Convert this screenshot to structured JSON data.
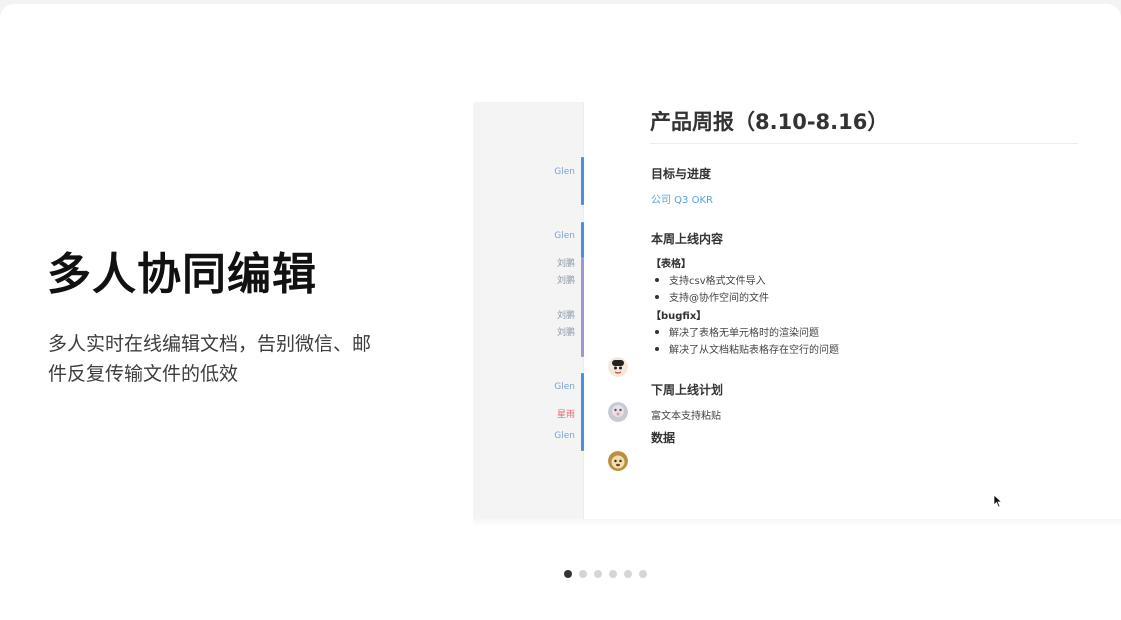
{
  "hero": {
    "title": "多人协同编辑",
    "description": "多人实时在线编辑文档，告别微信、邮件反复传输文件的低效"
  },
  "document": {
    "title": "产品周报（8.10-8.16）",
    "sections": {
      "goals_heading": "目标与进度",
      "goals_link": "公司 Q3 OKR",
      "release_heading": "本周上线内容",
      "table_tag": "【表格】",
      "table_items": [
        "支持csv格式文件导入",
        "支持@协作空间的文件"
      ],
      "bugfix_tag": "【bugfix】",
      "bugfix_items": [
        "解决了表格无单元格时的渲染问题",
        "解决了从文档粘贴表格存在空行的问题"
      ],
      "plan_heading": "下周上线计划",
      "plan_item": "富文本支持粘贴",
      "data_heading": "数据"
    }
  },
  "authors": {
    "a1": "Glen",
    "a2": "Glen",
    "a3": "刘鹏",
    "a4": "刘鹏",
    "a5": "刘鹏",
    "a6": "刘鹏",
    "a7": "Glen",
    "a8": "星雨",
    "a9": "Glen"
  },
  "colors": {
    "glen_bar": "#4a90e2",
    "liupeng_bar": "#9a9ac8",
    "xingyu_text": "#d86b6b"
  },
  "carousel": {
    "total": 6,
    "active_index": 0
  }
}
